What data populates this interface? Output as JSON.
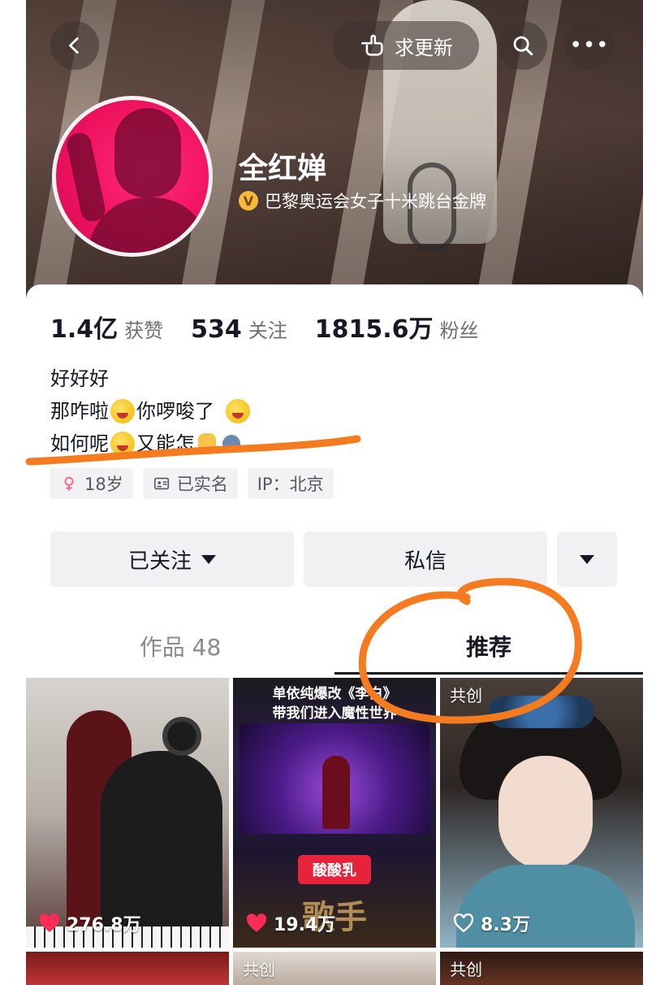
{
  "header": {
    "back_icon": "chevron-left-icon",
    "update_label": "求更新",
    "update_icon": "point-hand-icon",
    "search_icon": "search-icon",
    "more_label": "•••"
  },
  "profile": {
    "name": "全红婵",
    "verify_mark": "V",
    "verify_text": "巴黎奥运会女子十米跳台金牌",
    "stats": [
      {
        "num": "1.4亿",
        "label": "获赞"
      },
      {
        "num": "534",
        "label": "关注"
      },
      {
        "num": "1815.6万",
        "label": "粉丝"
      }
    ],
    "bio": {
      "line1": "好好好",
      "line2a": "那咋啦",
      "line2b": "你啰唆了",
      "line3a": "如何呢",
      "line3b": "又能怎"
    },
    "tags": {
      "age": "18岁",
      "realname": "已实名",
      "ip": "IP：北京"
    }
  },
  "actions": {
    "follow_label": "已关注",
    "message_label": "私信"
  },
  "tabs": {
    "works": "作品 48",
    "recommend": "推荐"
  },
  "grid": {
    "items": [
      {
        "likes": "276.8万",
        "liked": true
      },
      {
        "likes": "19.4万",
        "liked": true,
        "caption1": "单依纯爆改《李白》",
        "caption2": "带我们进入魔性世界",
        "logo": "酸酸乳",
        "logo_sub": "歌手"
      },
      {
        "likes": "8.3万",
        "liked": false,
        "badge": "共创"
      }
    ],
    "row2": [
      {
        "badge": ""
      },
      {
        "badge": "共创"
      },
      {
        "badge": "共创"
      }
    ]
  },
  "colors": {
    "accent_like": "#fe2c55",
    "annotation": "#f47b20",
    "avatar_pink": "#f0125f",
    "verify_gold": "#f6b93b"
  }
}
